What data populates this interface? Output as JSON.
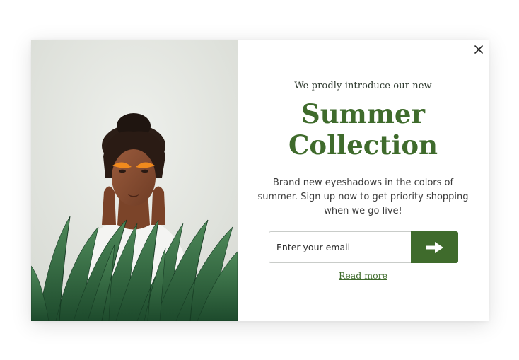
{
  "modal": {
    "close_icon": "close-icon",
    "image_alt_subject": "woman-with-palm-leaves-photo",
    "kicker": "We prodly introduce our new",
    "headline_line1": "Summer",
    "headline_line2": "Collection",
    "description": "Brand new eyeshadows in the colors of summer. Sign up now to get priority shopping when we go live!",
    "email_placeholder": "Enter your email",
    "email_value": "",
    "submit_icon": "arrow-right-icon",
    "read_more": "Read more",
    "accent_color": "#3f6b2c"
  }
}
